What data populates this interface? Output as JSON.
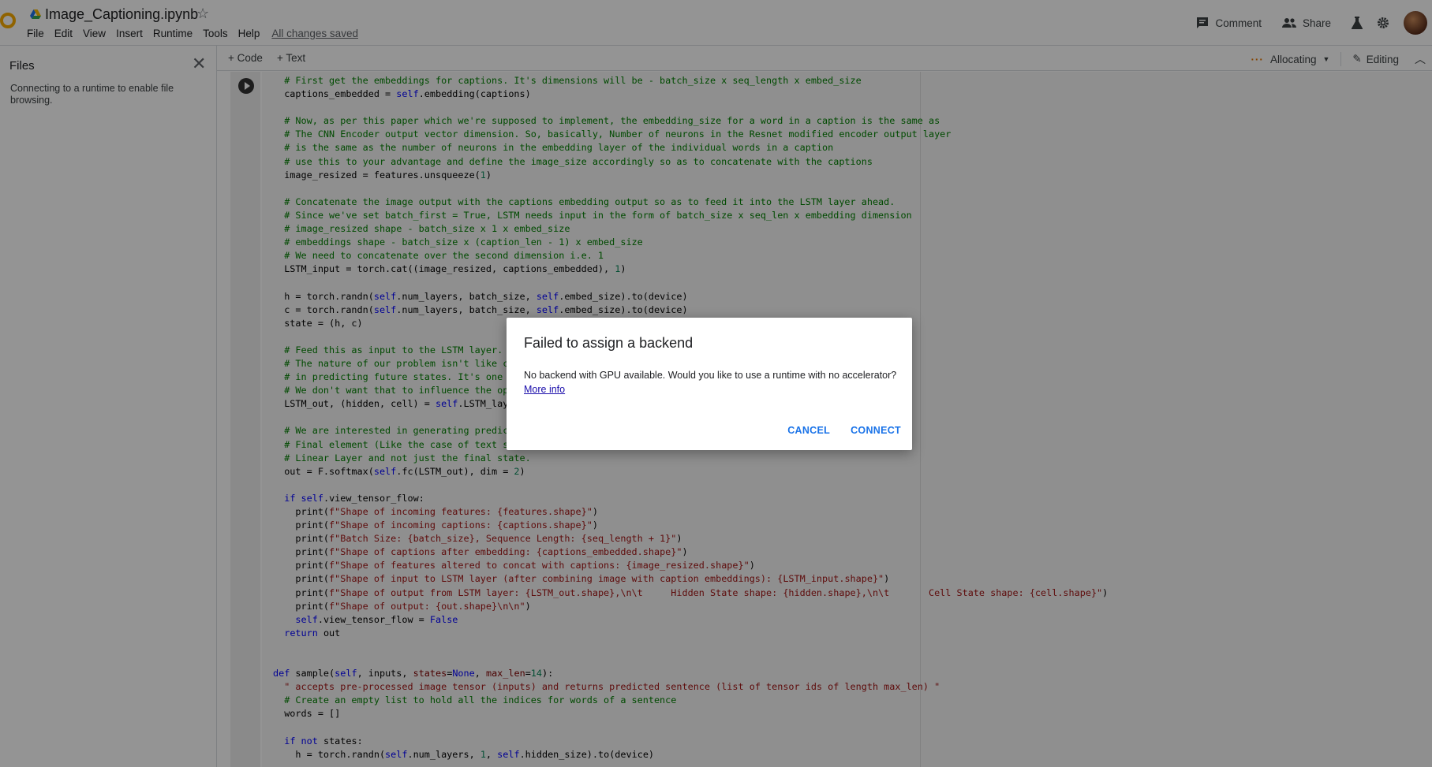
{
  "header": {
    "notebook_title": "Image_Captioning.ipynb",
    "menu": [
      "File",
      "Edit",
      "View",
      "Insert",
      "Runtime",
      "Tools",
      "Help"
    ],
    "save_status": "All changes saved",
    "comment_label": "Comment",
    "share_label": "Share"
  },
  "toolbar": {
    "add_code": "+ Code",
    "add_text": "+ Text",
    "runtime_status": "Allocating",
    "mode": "Editing"
  },
  "sidebar": {
    "title": "Files",
    "message": "Connecting to a runtime to enable file browsing."
  },
  "code_lines": [
    "# First get the embeddings for captions. It's dimensions will be - batch_size x seq_length x embed_size",
    "captions_embedded = self.embedding(captions)",
    "",
    "# Now, as per this paper which we're supposed to implement, the embedding_size for a word in a caption is the same as",
    "# The CNN Encoder output vector dimension. So, basically, Number of neurons in the Resnet modified encoder output layer",
    "# is the same as the number of neurons in the embedding layer of the individual words in a caption",
    "# use this to your advantage and define the image_size accordingly so as to concatenate with the captions",
    "image_resized = features.unsqueeze(1)",
    "",
    "# Concatenate the image output with the captions embedding output so as to feed it into the LSTM layer ahead.",
    "# Since we've set batch_first = True, LSTM needs input in the form of batch_size x seq_len x embedding dimension",
    "# image_resized shape - batch_size x 1 x embed_size",
    "# embeddings shape - batch_size x (caption_len - 1) x embed_size",
    "# We need to concatenate over the second dimension i.e. 1",
    "LSTM_input = torch.cat((image_resized, captions_embedded), 1)",
    "",
    "h = torch.randn(self.num_layers, batch_size, self.embed_size).to(device)",
    "c = torch.randn(self.num_layers, batch_size, self.embed_size).to(device)",
    "state = (h, c)",
    "",
    "# Feed this as input to the LSTM layer.",
    "# The nature of our problem isn't like c",
    "# in predicting future states. It's one",
    "# We don't want that to influence the op",
    "LSTM_out, (hidden, cell) = self.LSTM_lay",
    "",
    "# We are interested in generating predic",
    "# Final element (Like the case of text s",
    "# Linear Layer and not just the final state.",
    "out = F.softmax(self.fc(LSTM_out), dim = 2)",
    "",
    "if self.view_tensor_flow:",
    "  print(f\"Shape of incoming features: {features.shape}\")",
    "  print(f\"Shape of incoming captions: {captions.shape}\")",
    "  print(f\"Batch Size: {batch_size}, Sequence Length: {seq_length + 1}\")",
    "  print(f\"Shape of captions after embedding: {captions_embedded.shape}\")",
    "  print(f\"Shape of features altered to concat with captions: {image_resized.shape}\")",
    "  print(f\"Shape of input to LSTM layer (after combining image with caption embeddings): {LSTM_input.shape}\")",
    "  print(f\"Shape of output from LSTM layer: {LSTM_out.shape},\\n\\t     Hidden State shape: {hidden.shape},\\n\\t       Cell State shape: {cell.shape}\")",
    "  print(f\"Shape of output: {out.shape}\\n\\n\")",
    "  self.view_tensor_flow = False",
    "return out",
    "",
    "",
    "def sample(self, inputs, states=None, max_len=14):",
    "  \" accepts pre-processed image tensor (inputs) and returns predicted sentence (list of tensor ids of length max_len) \"",
    "  # Create an empty list to hold all the indices for words of a sentence",
    "  words = []",
    "",
    "  if not states:",
    "    h = torch.randn(self.num_layers, 1, self.hidden_size).to(device)"
  ],
  "dialog": {
    "title": "Failed to assign a backend",
    "message": "No backend with GPU available. Would you like to use a runtime with no accelerator?",
    "link": "More info",
    "cancel": "CANCEL",
    "connect": "CONNECT"
  }
}
